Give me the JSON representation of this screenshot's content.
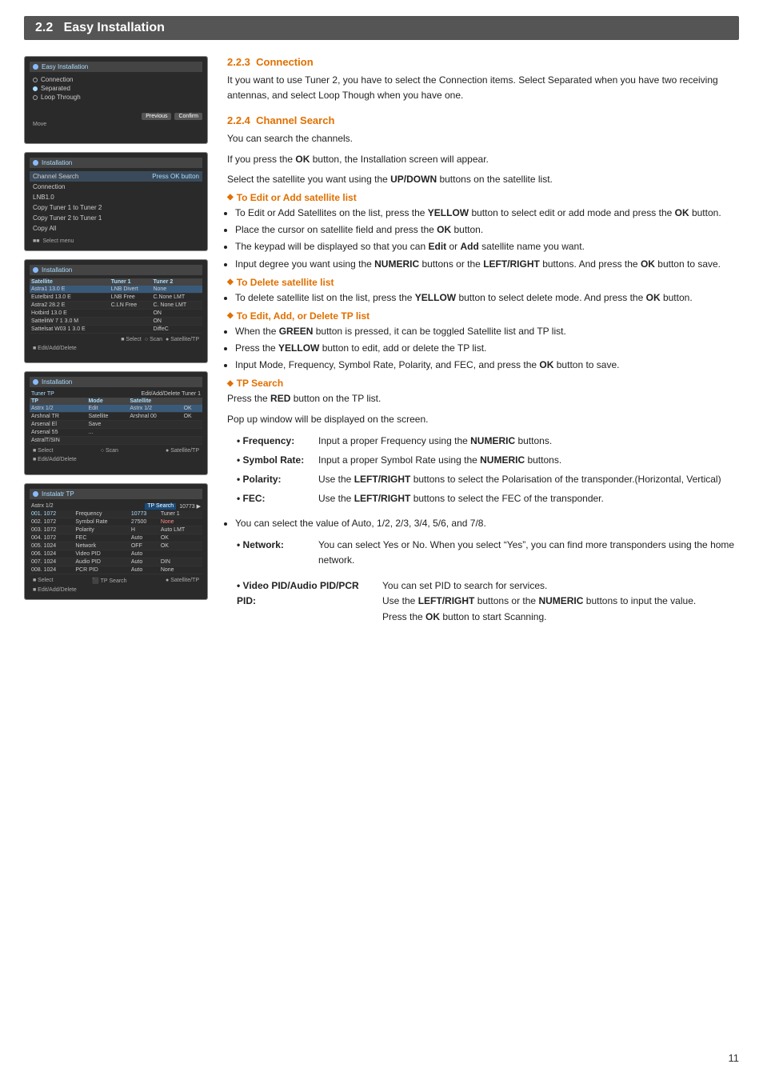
{
  "section": {
    "number": "2.2",
    "title": "Easy Installation"
  },
  "subsections": [
    {
      "id": "2.2.3",
      "title": "2.2.3  Connection",
      "paragraphs": [
        "It you want to use Tuner 2, you have to select the Connection items. Select Separated when you have two receiving antennas, and select Loop Though when you have one."
      ]
    },
    {
      "id": "2.2.4",
      "title": "2.2.4  Channel Search",
      "paragraphs": [
        "You can search the channels.",
        "If you press the OK button, the Installation screen will appear.",
        "Select the satellite you want using the UP/DOWN buttons on the satellite list."
      ]
    }
  ],
  "diamond_sections": [
    {
      "title": "To Edit or Add satellite list",
      "items": [
        "To Edit or Add Satellites on the list, press the YELLOW button to select edit or add mode and press the OK button.",
        "Place the cursor on satellite field and press the OK button.",
        "The keypad will be displayed so that you can Edit or Add satellite name you want.",
        "Input degree you want using the NUMERIC buttons or the LEFT/RIGHT buttons. And press the OK button to save."
      ]
    },
    {
      "title": "To Delete satellite list",
      "items": [
        "To delete satellite list on the list, press the YELLOW button to select delete mode. And press the OK button."
      ]
    },
    {
      "title": "To Edit, Add, or Delete TP list",
      "items": [
        "When the GREEN button is pressed, it can be toggled Satellite list and TP list.",
        "Press the YELLOW button to edit, add or delete the TP list.",
        "Input Mode, Frequency, Symbol Rate, Polarity, and FEC, and press the OK button to save."
      ]
    },
    {
      "title": "TP Search",
      "intro": "Press the RED button on the TP list.\nPop up window will be displayed on the screen.",
      "table_rows": [
        {
          "label": "Frequency:",
          "value": "Input a proper Frequency using the NUMERIC buttons."
        },
        {
          "label": "Symbol Rate:",
          "value": "Input a proper Symbol Rate using the NUMERIC buttons."
        },
        {
          "label": "Polarity:",
          "value": "Use the LEFT/RIGHT buttons to select the Polarisation of the transponder.(Horizontal, Vertical)"
        },
        {
          "label": "FEC:",
          "value": "Use the LEFT/RIGHT buttons to select the FEC of the transponder."
        }
      ],
      "extra_items": [
        "You can select the value of Auto, 1/2, 2/3, 3/4, 5/6, and 7/8.",
        {
          "label": "Network:",
          "value": "You can select Yes or No. When you select \"Yes\", you can find more transponders using the home network."
        }
      ],
      "video_pid": {
        "label": "Video PID/Audio PID/PCR PID:",
        "lines": [
          "You can set PID to search for services.",
          "Use the LEFT/RIGHT buttons or the NUMERIC buttons to input the value.",
          "Press the OK button to start Scanning."
        ]
      }
    }
  ],
  "screens": [
    {
      "id": "screen1",
      "title": "Easy Installation",
      "items": [
        "Connection",
        "Separated",
        "Loop Through"
      ],
      "selected": 1
    },
    {
      "id": "screen2",
      "title": "Installation",
      "menu_items": [
        "Channel Search",
        "Connection",
        "LNB1.0",
        "Copy Tuner 1 to Tuner 2",
        "Copy Tuner 2 to Tuner 1",
        "Copy All"
      ],
      "bottom": "Select menu"
    },
    {
      "id": "screen3",
      "title": "Installation - Satellite"
    },
    {
      "id": "screen4",
      "title": "Installation - TP Edit"
    },
    {
      "id": "screen5",
      "title": "Installation - TP Search"
    }
  ],
  "keywords": {
    "yellow": "YELLOW",
    "ok": "OK",
    "green": "GREEN",
    "red": "RED",
    "numeric": "NUMERIC",
    "left_right": "LEFT/RIGHT",
    "up_down": "UP/DOWN",
    "edit": "Edit",
    "add": "Add"
  },
  "page_number": "11"
}
